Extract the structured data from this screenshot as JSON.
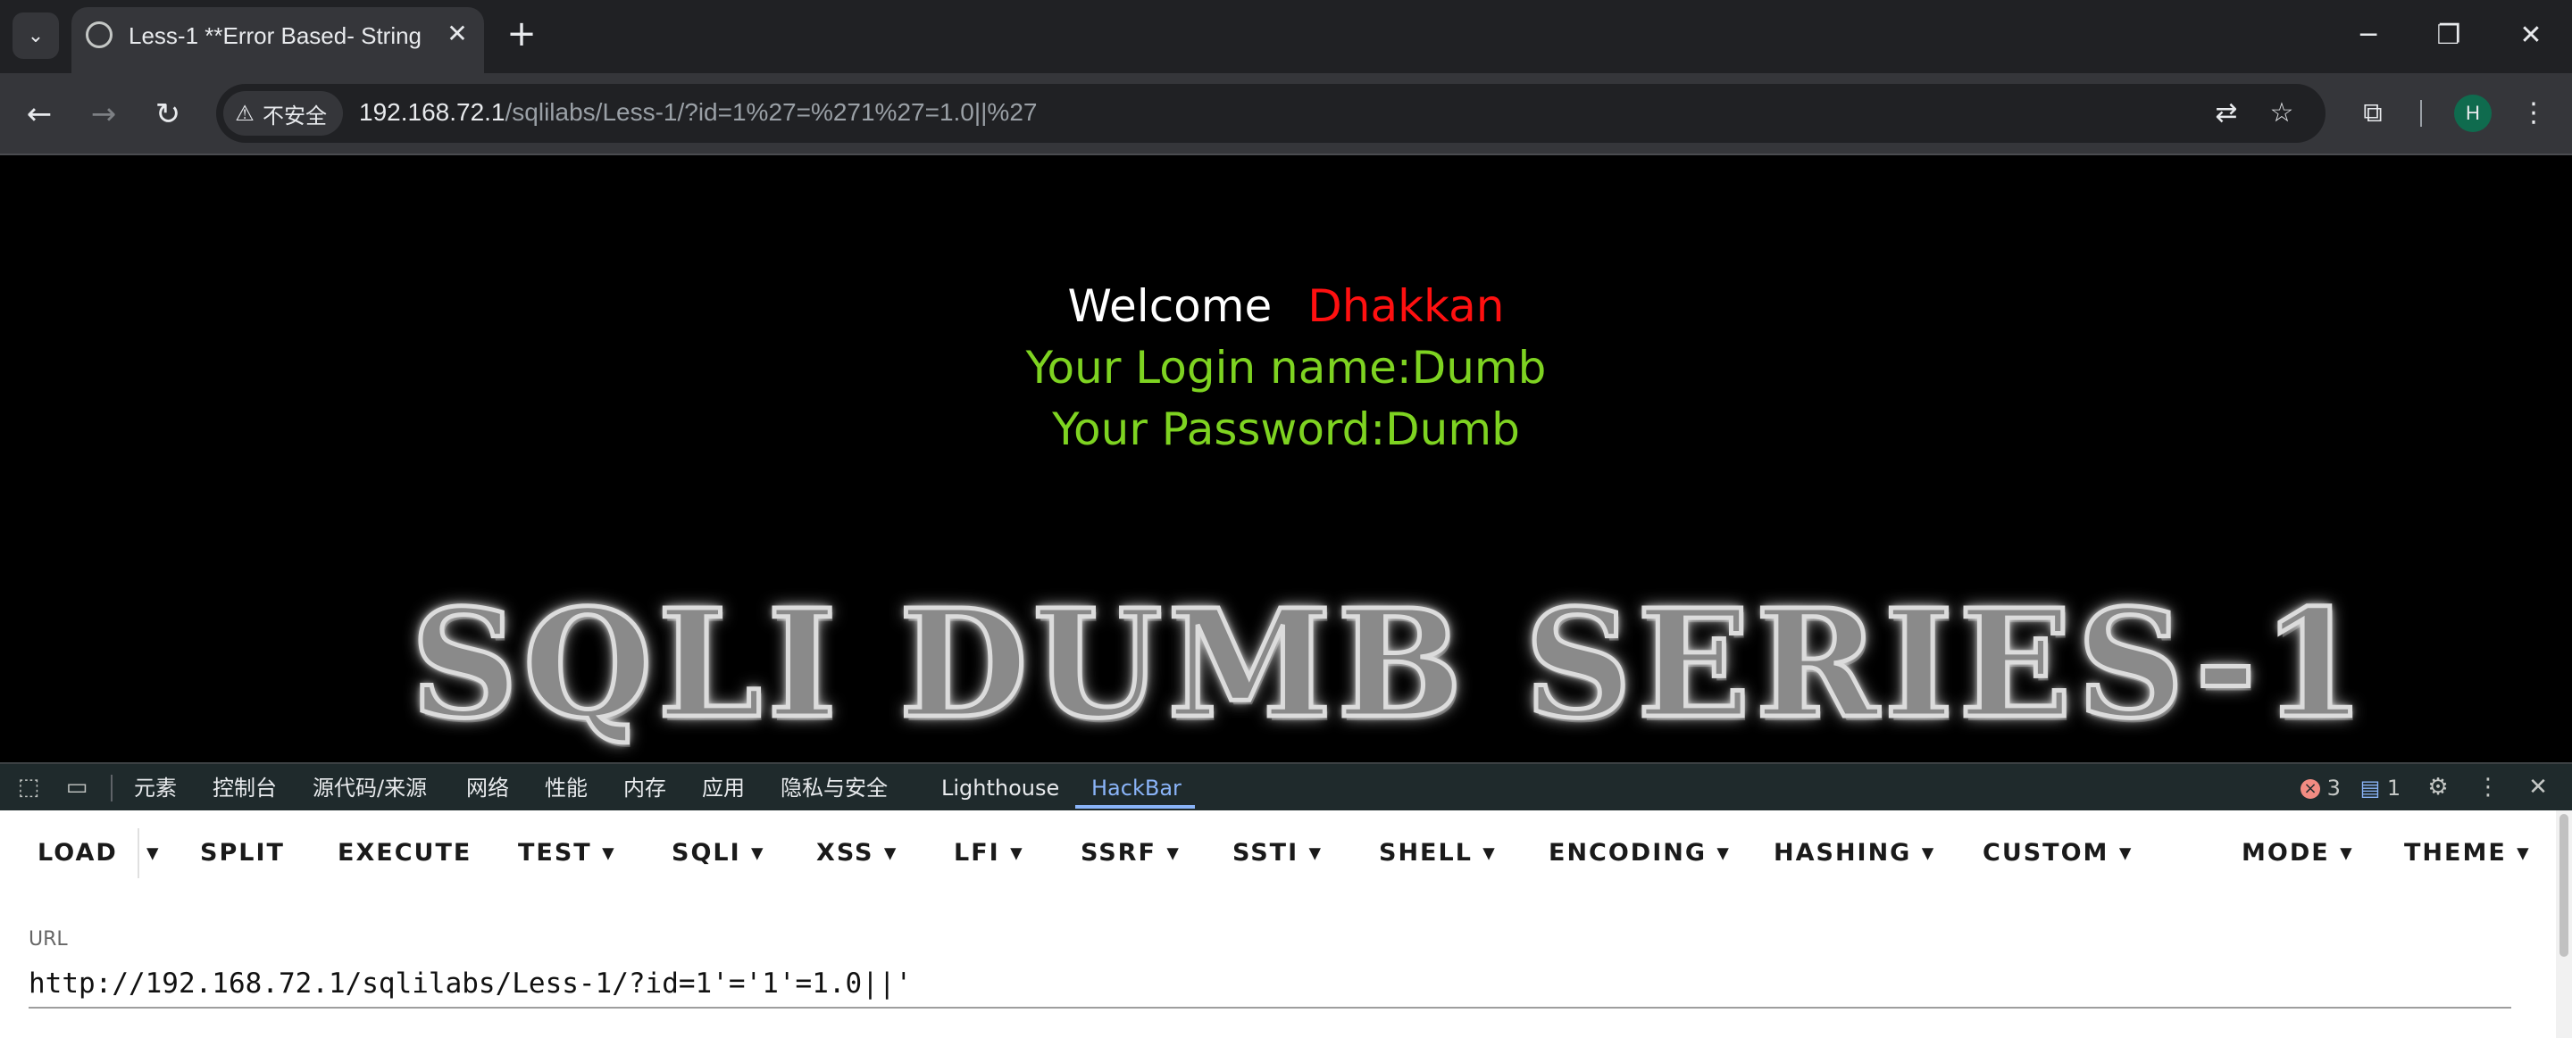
{
  "browser": {
    "tab_title": "Less-1 **Error Based- String**",
    "security_label": "不安全",
    "url_host": "192.168.72.1",
    "url_path": "/sqlilabs/Less-1/?id=1%27=%271%27=1.0||%27",
    "profile_initial": "H"
  },
  "page": {
    "welcome": "Welcome",
    "name": "Dhakkan",
    "login_line": "Your Login name:Dumb",
    "password_line": "Your Password:Dumb",
    "banner": "SQLI DUMB SERIES-1"
  },
  "devtools": {
    "tabs": [
      "元素",
      "控制台",
      "源代码/来源",
      "网络",
      "性能",
      "内存",
      "应用",
      "隐私与安全",
      "Lighthouse",
      "HackBar"
    ],
    "error_count": "3",
    "message_count": "1"
  },
  "hackbar": {
    "buttons": [
      "LOAD",
      "SPLIT",
      "EXECUTE",
      "TEST",
      "SQLI",
      "XSS",
      "LFI",
      "SSRF",
      "SSTI",
      "SHELL",
      "ENCODING",
      "HASHING",
      "CUSTOM",
      "MODE",
      "THEME"
    ],
    "url_label": "URL",
    "url_value": "http://192.168.72.1/sqlilabs/Less-1/?id=1'='1'=1.0||'"
  }
}
